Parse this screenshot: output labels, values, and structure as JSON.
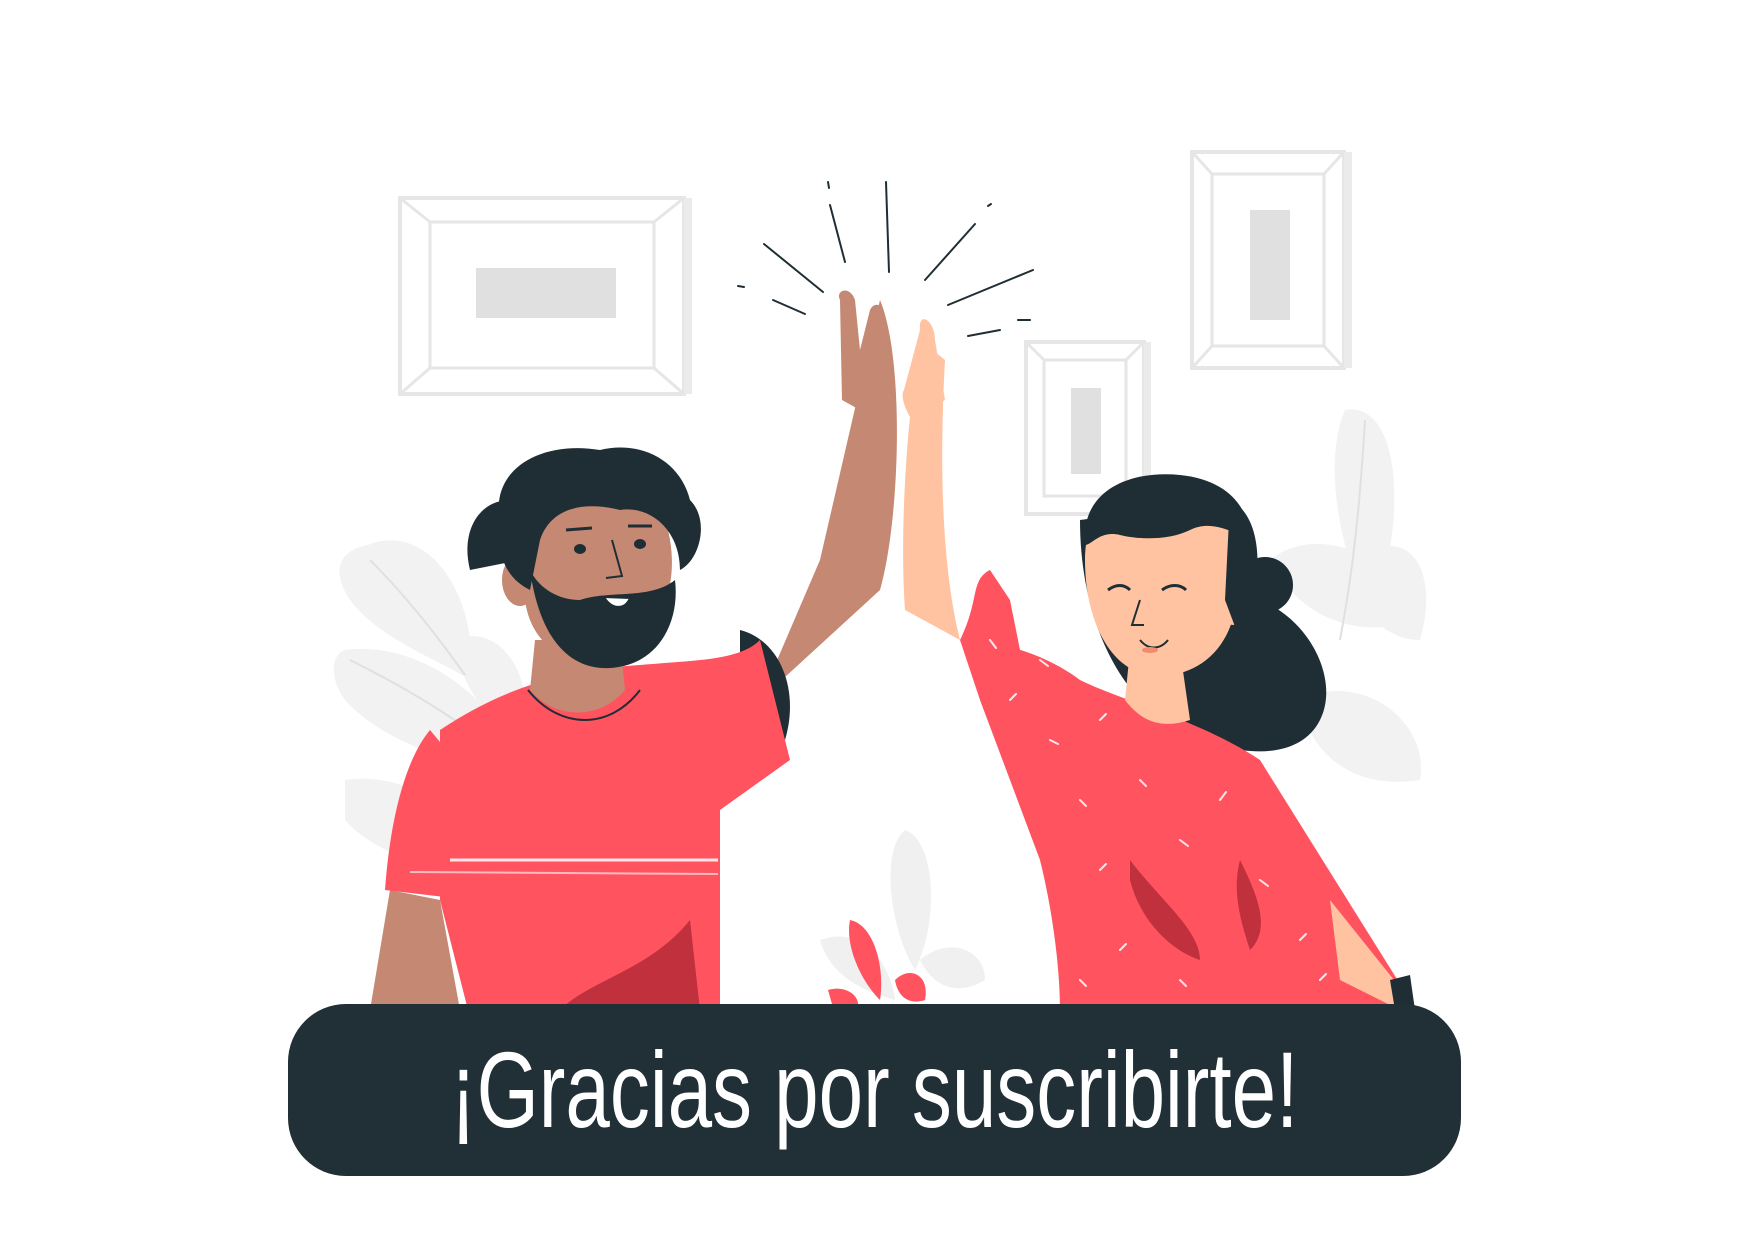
{
  "banner": {
    "text": "¡Gracias por suscribirte!"
  },
  "colors": {
    "background": "#ffffff",
    "banner": "#212f36",
    "banner_text": "#ffffff",
    "shirt_red": "#ff5360",
    "shirt_shadow": "#c0303d",
    "hair": "#1f2e35",
    "skin_dark": "#c58872",
    "skin_light": "#ffc3a1",
    "frame_grey": "#e6e6e6",
    "leaf_grey": "#f2f2f2"
  },
  "illustration": {
    "subject": "two people giving a high-five",
    "icons": [
      "picture-frame-icon",
      "leaf-icon",
      "sparkle-lines-icon"
    ]
  }
}
